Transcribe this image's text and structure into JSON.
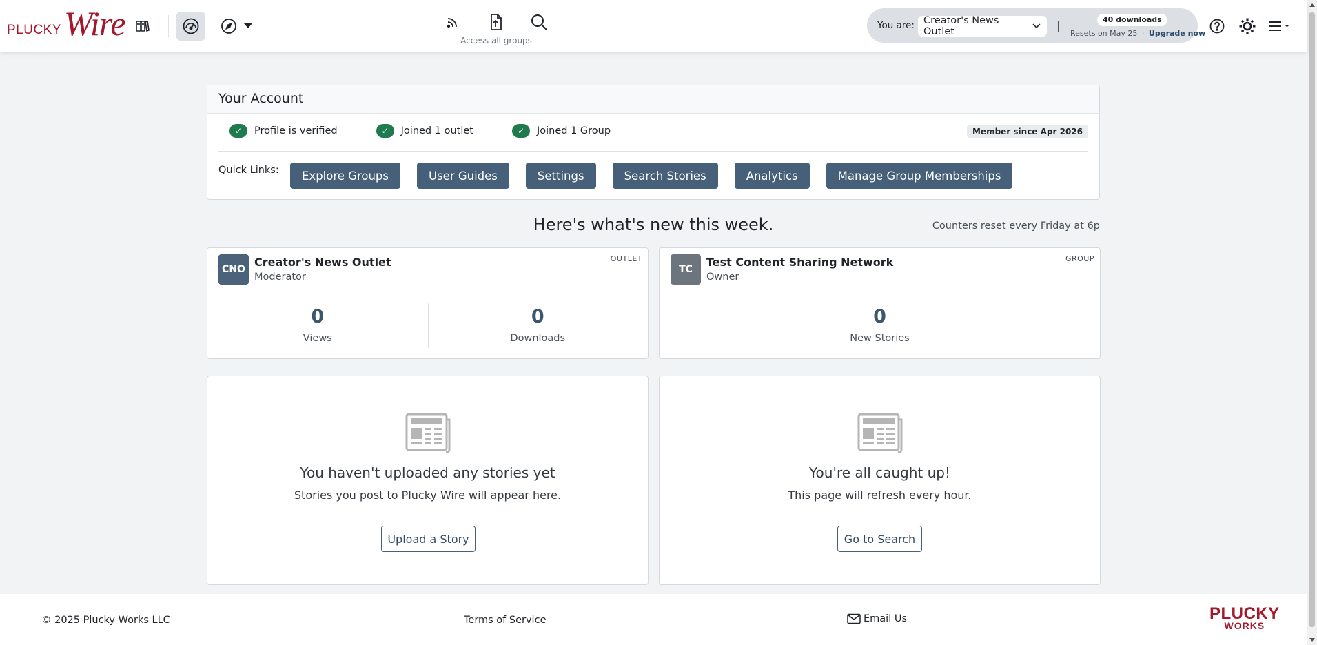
{
  "brand": {
    "logo_top": "PLUCKY",
    "logo_main": "Wire",
    "color": "#a4182c"
  },
  "topnav": {
    "icons": [
      "library-icon",
      "dashboard-gauge-icon",
      "compass-icon",
      "rss-feed-icon",
      "upload-icon",
      "search-icon"
    ],
    "access_label": "Access all groups",
    "you_are_label": "You are:",
    "selected_outlet": "Creator's News Outlet",
    "downloads_badge": "40 downloads",
    "resets_text": "Resets on May 25",
    "resets_sep": "·",
    "upgrade_link": "Upgrade now"
  },
  "account": {
    "title": "Your Account",
    "checks": [
      "Profile is verified",
      "Joined 1 outlet",
      "Joined 1 Group"
    ],
    "member_since": "Member since Apr 2026",
    "quick_links_label": "Quick Links:",
    "quick_links": [
      "Explore Groups",
      "User Guides",
      "Settings",
      "Search Stories",
      "Analytics",
      "Manage Group Memberships"
    ]
  },
  "week": {
    "title": "Here's what's new this week.",
    "counters_note": "Counters reset every Friday at 6p"
  },
  "cards": [
    {
      "avatar": "CNO",
      "avatar_color": "#4a627a",
      "name": "Creator's News Outlet",
      "role": "Moderator",
      "type": "OUTLET",
      "stats": [
        {
          "value": "0",
          "label": "Views"
        },
        {
          "value": "0",
          "label": "Downloads"
        }
      ]
    },
    {
      "avatar": "TC",
      "avatar_color": "#6c757d",
      "name": "Test Content Sharing Network",
      "role": "Owner",
      "type": "GROUP",
      "stats": [
        {
          "value": "0",
          "label": "New Stories"
        }
      ]
    }
  ],
  "empty_states": [
    {
      "title": "You haven't uploaded any stories yet",
      "subtitle": "Stories you post to Plucky Wire will appear here.",
      "button": "Upload a Story"
    },
    {
      "title": "You're all caught up!",
      "subtitle": "This page will refresh every hour.",
      "button": "Go to Search"
    }
  ],
  "footer": {
    "copyright": "© 2025 Plucky Works LLC",
    "terms": "Terms of Service",
    "email": "Email Us",
    "logo_top": "PLUCKY",
    "logo_bottom": "WORKS"
  }
}
